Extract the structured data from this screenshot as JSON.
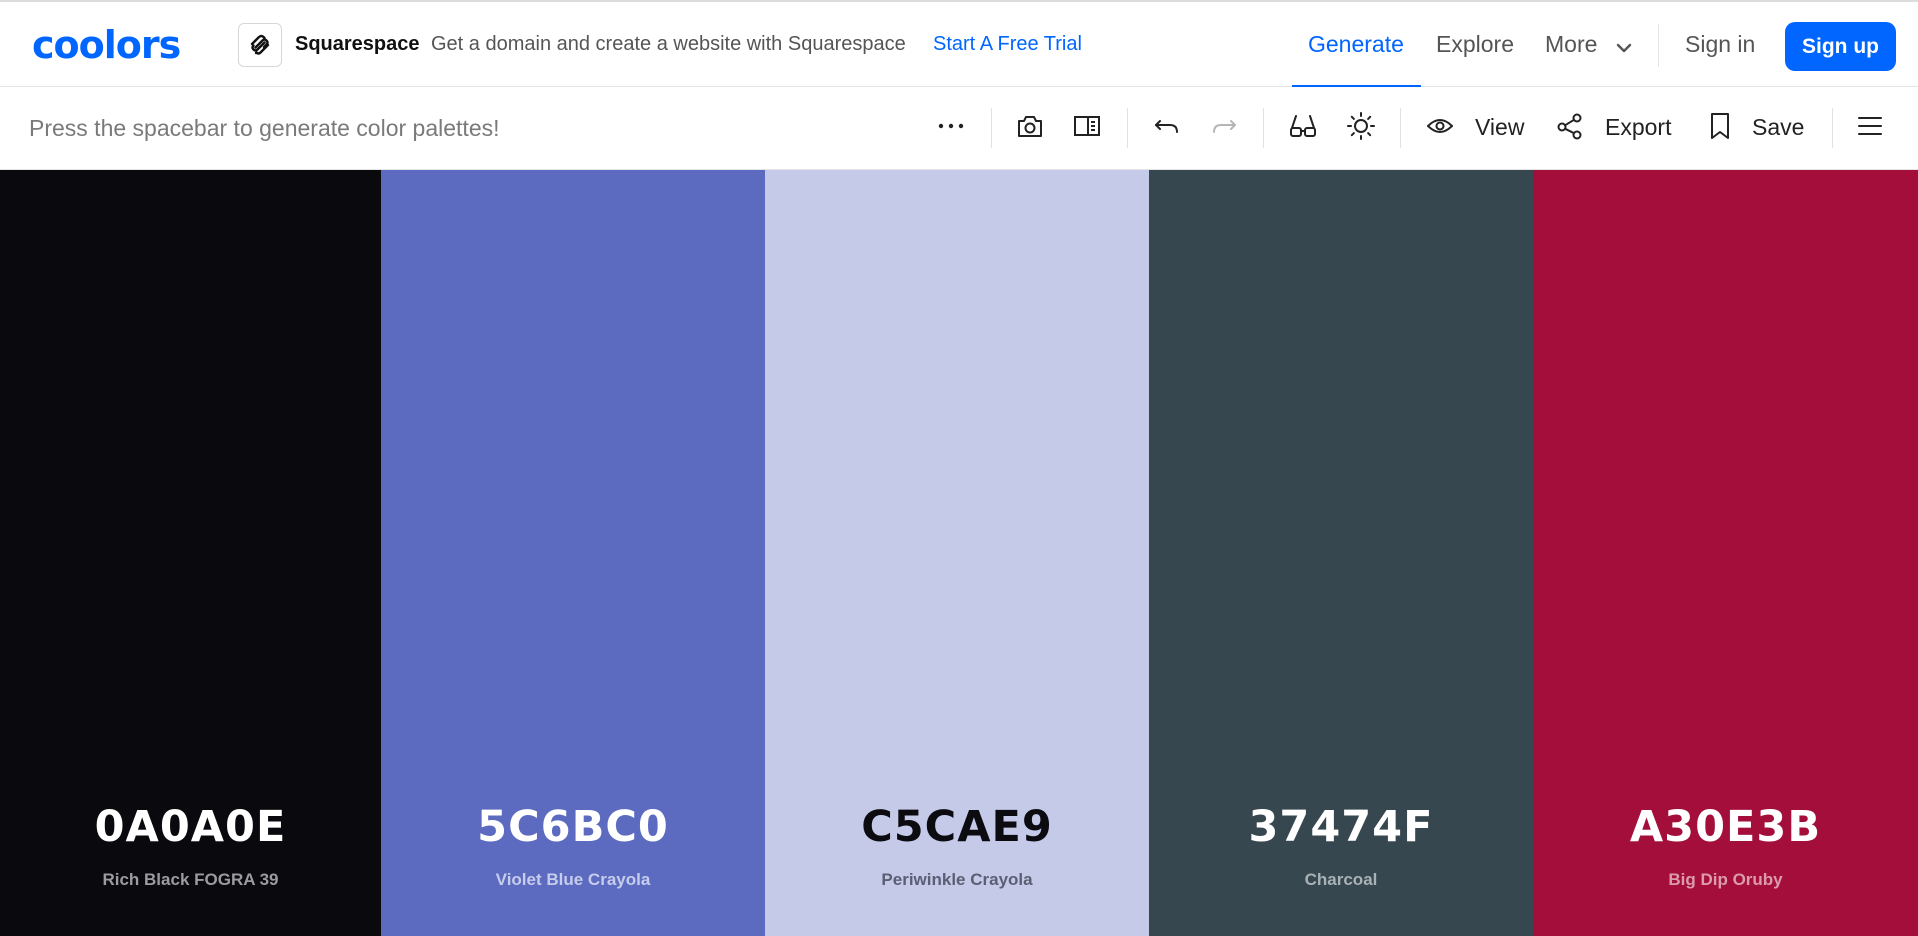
{
  "brand": {
    "logo_text": "coolors"
  },
  "ad": {
    "name": "Squarespace",
    "description": "Get a domain and create a website with Squarespace",
    "cta": "Start A Free Trial"
  },
  "nav": {
    "generate": "Generate",
    "explore": "Explore",
    "more": "More",
    "sign_in": "Sign in",
    "sign_up": "Sign up"
  },
  "toolbar": {
    "hint": "Press the spacebar to generate color palettes!",
    "view_label": "View",
    "export_label": "Export",
    "save_label": "Save"
  },
  "colors": {
    "accent": "#0066ff",
    "toolbar_icon": "#222222",
    "disabled_icon": "#b5b5b5"
  },
  "palette": [
    {
      "hex": "0A0A0E",
      "name": "Rich Black FOGRA 39",
      "color": "#0a0a0e",
      "text_color": "#ffffff",
      "name_color": "#9c9c9f"
    },
    {
      "hex": "5C6BC0",
      "name": "Violet Blue Crayola",
      "color": "#5c6bc0",
      "text_color": "#ffffff",
      "name_color": "#c6ccec"
    },
    {
      "hex": "C5CAE9",
      "name": "Periwinkle Crayola",
      "color": "#c5cae9",
      "text_color": "#0b0b10",
      "name_color": "#5b5f73"
    },
    {
      "hex": "37474F",
      "name": "Charcoal",
      "color": "#37474f",
      "text_color": "#ffffff",
      "name_color": "#a8b1b5"
    },
    {
      "hex": "A30E3B",
      "name": "Big Dip Oruby",
      "color": "#a30e3b",
      "text_color": "#ffffff",
      "name_color": "#dc9aae"
    }
  ]
}
